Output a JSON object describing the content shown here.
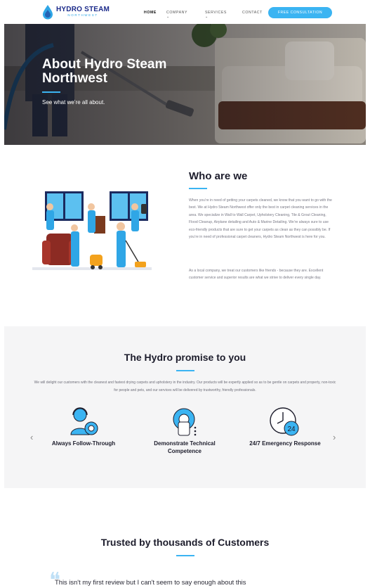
{
  "nav": {
    "logo_main": "HYDRO STEAM",
    "logo_sub": "NORTHWEST",
    "home": "HOME",
    "company": "COMPANY ⌄",
    "services": "SERVICES ⌄",
    "contact": "CONTACT",
    "cta": "FREE CONSULTATION"
  },
  "hero": {
    "title": "About Hydro Steam Northwest",
    "subtitle": "See what we’re all about."
  },
  "who": {
    "title": "Who are we",
    "p1": "When you’re in need of getting your carpets cleaned, we know that you want to go with the best. We at Hydro Steam Northwest offer only the best in carpet cleaning services in the area. We specialize in Wall to Wall Carpet, Upholstery Cleaning, Tile & Grout Cleaning, Flood Cleanup, Airplane detailing and Auto & Marine Detailing. We’re always sure to use eco-friendly products that are sure to get your carpets as clean as they can possibly be. If you’re in need of professional carpet cleaners, Hydro Steam Northwest is here for you.",
    "p2": "As a local company, we treat our customers like friends - because they are. Excellent customer service and superior results are what we strive to deliver every single day."
  },
  "promise": {
    "title": "The Hydro promise to you",
    "desc": "We will delight our customers with the cleanest and fastest drying carpets and upholstery in the industry. Our products will be expertly applied so as to be gentle on carpets and property, non-toxic for people and pets, and our services will be delivered by trustworthy, friendly professionals.",
    "features": [
      {
        "label": "Always Follow-Through",
        "icon": "support-agent-icon"
      },
      {
        "label": "Demonstrate Technical Competence",
        "icon": "technician-gear-icon"
      },
      {
        "label": "24/7 Emergency Response",
        "icon": "clock-24-icon",
        "badge": "24"
      }
    ],
    "prev": "‹",
    "next": "›"
  },
  "trusted": {
    "title": "Trusted by thousands of Customers",
    "review": "This isn't my first review but I can't seem to say enough about this"
  },
  "colors": {
    "accent": "#3bb4f2",
    "brand": "#1b2a8a",
    "text": "#1d1d2c"
  }
}
